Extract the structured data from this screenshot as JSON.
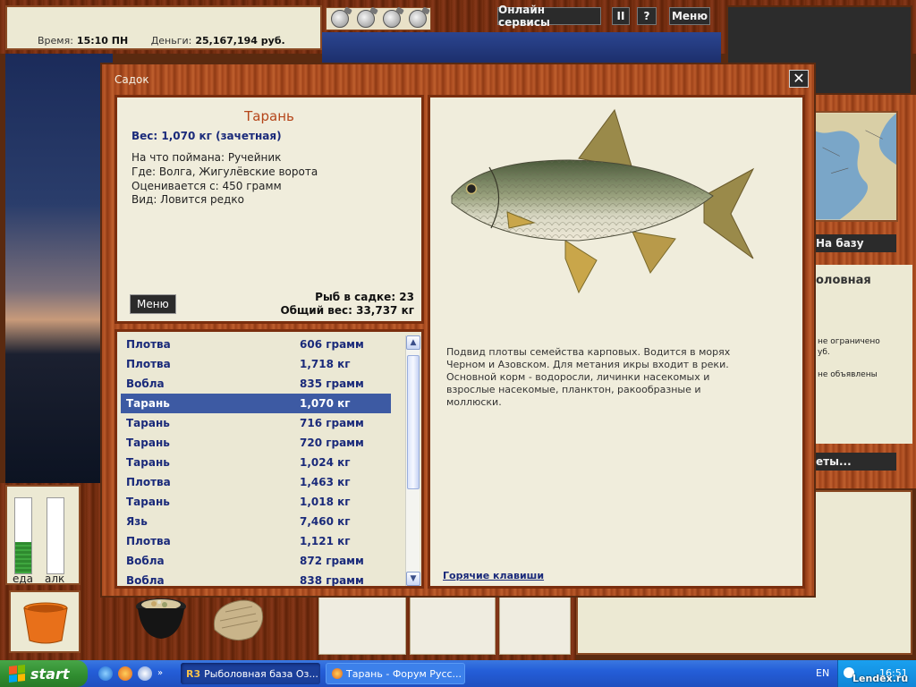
{
  "stats": {
    "time_label": "Время:",
    "time_value": "15:10 ПН",
    "money_label": "Деньги:",
    "money_value": "25,167,194 руб."
  },
  "toolbar": {
    "online": "Онлайн сервисы",
    "pause": "II",
    "help": "?",
    "menu": "Меню"
  },
  "right_side": {
    "to_base": "На базу",
    "title_partial": "оловная",
    "line1": "не ограничено",
    "line2": "уб.",
    "line3": "не объявлены",
    "more_btn": "еты..."
  },
  "meters": {
    "food_label": "еда",
    "food_level": 0.42,
    "alc_label": "алк",
    "alc_level": 0.0
  },
  "dialog": {
    "title": "Садок",
    "close": "✕",
    "fish": {
      "name": "Тарань",
      "weight": "Вес: 1,070 кг (зачетная)",
      "bait": "На что поймана: Ручейник",
      "place": "Где: Волга, Жигулёвские ворота",
      "price": "Оценивается с: 450 грамм",
      "kind": "Вид: Ловится редко"
    },
    "menu_button": "Меню",
    "summary": {
      "count": "Рыб в садке: 23",
      "total": "Общий вес: 33,737 кг"
    },
    "description": "Подвид плотвы семейства карповых. Водится в морях Черном и Азовском. Для метания икры входит в реки. Основной корм - водоросли, личинки насекомых и взрослые насекомые, планктон, ракообразные и моллюски.",
    "hotkeys": "Горячие клавиши",
    "fish_list": [
      {
        "name": "Плотва",
        "weight": "606 грамм"
      },
      {
        "name": "Плотва",
        "weight": "1,718 кг"
      },
      {
        "name": "Вобла",
        "weight": "835 грамм"
      },
      {
        "name": "Тарань",
        "weight": "1,070 кг"
      },
      {
        "name": "Тарань",
        "weight": "716 грамм"
      },
      {
        "name": "Тарань",
        "weight": "720 грамм"
      },
      {
        "name": "Тарань",
        "weight": "1,024 кг"
      },
      {
        "name": "Плотва",
        "weight": "1,463 кг"
      },
      {
        "name": "Тарань",
        "weight": "1,018 кг"
      },
      {
        "name": "Язь",
        "weight": "7,460 кг"
      },
      {
        "name": "Плотва",
        "weight": "1,121 кг"
      },
      {
        "name": "Вобла",
        "weight": "872 грамм"
      },
      {
        "name": "Вобла",
        "weight": "838 грамм"
      }
    ],
    "selected_index": 3
  },
  "taskbar": {
    "start": "start",
    "tasks": [
      "Рыболовная база Оз...",
      "Тарань - Форум Русс..."
    ],
    "lang": "EN",
    "clock": "16:51",
    "watermark": "Lendex.ru"
  },
  "colors": {
    "wood": "#a5471c",
    "panel": "#f0eddc",
    "fish_name": "#b5461a",
    "list_text": "#1a2a7a",
    "selected_row": "#3d5aa3"
  }
}
